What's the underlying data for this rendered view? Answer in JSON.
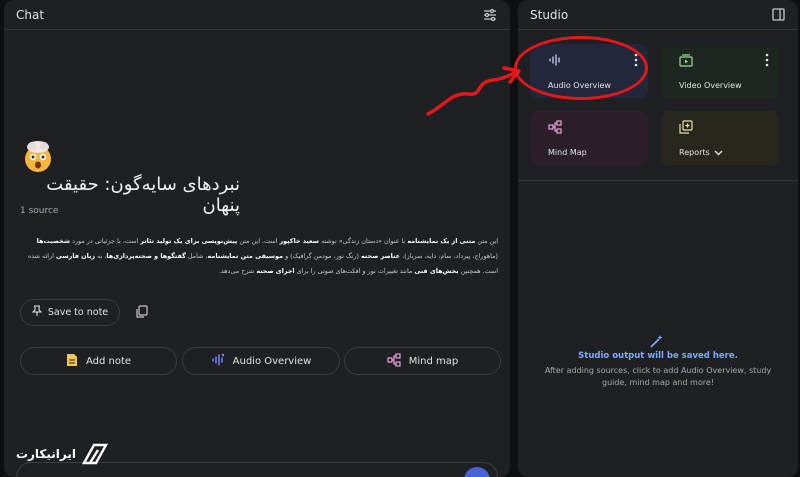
{
  "chat": {
    "title": "Chat",
    "notebook_title": "نبردهای سایه‌گون: حقیقت پنهان",
    "source_count": "1 source",
    "summary_parts": [
      "این متن ",
      "متنی از یک نمایشنامه",
      " با عنوان «دستان زندگی» نوشته ",
      "سعید خاکپور",
      " است. این متن ",
      "پیش‌نویسی برای یک تولید تئاتر",
      " است، با جزئیاتی در مورد ",
      "شخصیت‌ها",
      " (ماهوراج، پیرداد، سام، دایه، سرباز)، ",
      "عناصر صحنه",
      " (رنگ نور، مودمن گرافیک) و ",
      "موسیقی متن نمایشنامه",
      "، شامل ",
      "گفتگوها و صحنه‌پردازی‌ها",
      "، به ",
      "زبان فارسی",
      " ارائه شده است. همچنین ",
      "بخش‌های فنی",
      " مانند تغییرات نور و افکت‌های صوتی را برای ",
      "اجرای صحنه",
      " شرح می‌دهد."
    ],
    "save_label": "Save to note",
    "actions": {
      "add_note": "Add note",
      "audio_overview": "Audio Overview",
      "mind_map": "Mind map"
    }
  },
  "studio": {
    "title": "Studio",
    "tiles": {
      "audio": "Audio Overview",
      "video": "Video Overview",
      "mindmap": "Mind Map",
      "reports": "Reports"
    },
    "empty_title": "Studio output will be saved here.",
    "empty_desc": "After adding sources, click to add Audio Overview, study guide, mind map and more!"
  },
  "watermark": {
    "text": "ایرانیکارت"
  },
  "colors": {
    "annotation": "#e2181a",
    "accent_blue": "#7fa8ff",
    "note_yellow": "#f2c94c"
  },
  "icons": [
    "tune-icon",
    "panel-toggle-icon",
    "pin-icon",
    "copy-icon",
    "note-icon",
    "audio-wave-icon",
    "mind-map-icon",
    "video-icon",
    "reports-icon",
    "chevron-down-icon",
    "magic-wand-icon",
    "more-vert-icon"
  ]
}
